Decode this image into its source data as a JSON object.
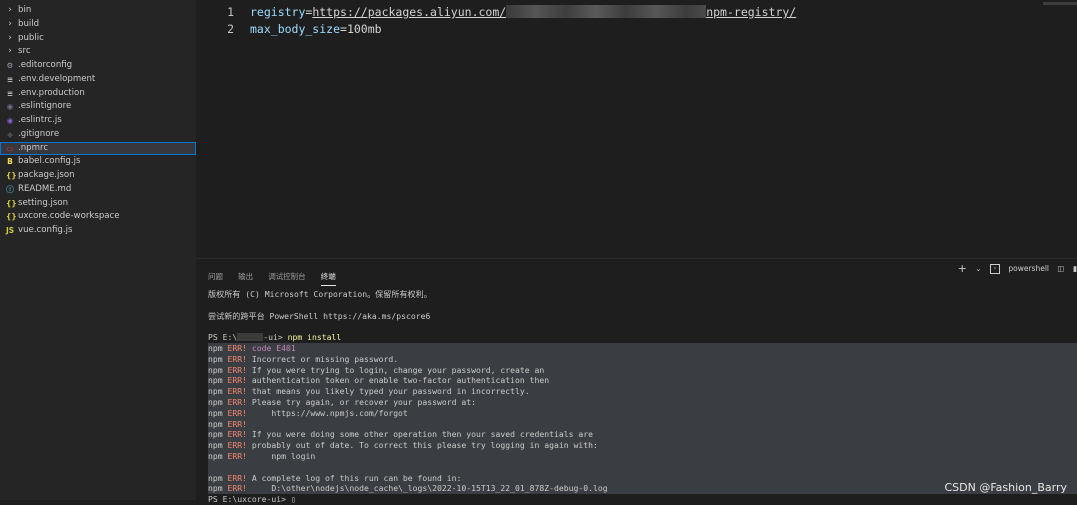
{
  "explorer": {
    "items": [
      {
        "type": "folder",
        "label": "bin",
        "icon": "chevron-right-icon",
        "glyph": "›",
        "color": "#c5c5c5"
      },
      {
        "type": "folder",
        "label": "build",
        "icon": "chevron-right-icon",
        "glyph": "›",
        "color": "#c5c5c5"
      },
      {
        "type": "folder",
        "label": "public",
        "icon": "chevron-right-icon",
        "glyph": "›",
        "color": "#c5c5c5"
      },
      {
        "type": "folder",
        "label": "src",
        "icon": "chevron-right-icon",
        "glyph": "›",
        "color": "#c5c5c5"
      },
      {
        "type": "file",
        "label": ".editorconfig",
        "icon": "gear-icon",
        "glyph": "⚙",
        "color": "#8fa3b3"
      },
      {
        "type": "file",
        "label": ".env.development",
        "icon": "list-icon",
        "glyph": "≡",
        "color": "#c5c5c5"
      },
      {
        "type": "file",
        "label": ".env.production",
        "icon": "list-icon",
        "glyph": "≡",
        "color": "#c5c5c5"
      },
      {
        "type": "file",
        "label": ".eslintignore",
        "icon": "circle-icon",
        "glyph": "◉",
        "color": "#6f6f8f"
      },
      {
        "type": "file",
        "label": ".eslintrc.js",
        "icon": "eslint-icon",
        "glyph": "◉",
        "color": "#8a5fd6"
      },
      {
        "type": "file",
        "label": ".gitignore",
        "icon": "git-icon",
        "glyph": "◆",
        "color": "#4d4d4d"
      },
      {
        "type": "file",
        "label": ".npmrc",
        "icon": "npm-icon",
        "glyph": "▭",
        "color": "#cb3837",
        "selected": true
      },
      {
        "type": "file",
        "label": "babel.config.js",
        "icon": "babel-icon",
        "glyph": "B",
        "color": "#f5da55"
      },
      {
        "type": "file",
        "label": "package.json",
        "icon": "json-braces-icon",
        "glyph": "{}",
        "color": "#cbcb41"
      },
      {
        "type": "file",
        "label": "README.md",
        "icon": "info-icon",
        "glyph": "ⓘ",
        "color": "#519aba"
      },
      {
        "type": "file",
        "label": "setting.json",
        "icon": "json-braces-icon",
        "glyph": "{}",
        "color": "#cbcb41"
      },
      {
        "type": "file",
        "label": "uxcore.code-workspace",
        "icon": "json-braces-icon",
        "glyph": "{}",
        "color": "#cbcb41"
      },
      {
        "type": "file",
        "label": "vue.config.js",
        "icon": "js-icon",
        "glyph": "JS",
        "color": "#cbcb41"
      }
    ]
  },
  "editor": {
    "lines": [
      {
        "num": "1",
        "key": "registry",
        "eq": "=",
        "value_prefix": "https://packages.aliyun.com/",
        "value_suffix": "npm-registry/"
      },
      {
        "num": "2",
        "key": "max_body_size",
        "eq": "=",
        "value": "100mb"
      }
    ]
  },
  "panel": {
    "tabs": [
      "问题",
      "输出",
      "调试控制台",
      "终端"
    ],
    "active_tab": "终端",
    "shell_label": "powershell",
    "terminal": {
      "lines": [
        {
          "text": "版权所有 (C) Microsoft Corporation。保留所有权利。"
        },
        {
          "text": ""
        },
        {
          "text": "尝试新的跨平台 PowerShell https://aka.ms/pscore6"
        },
        {
          "text": ""
        },
        {
          "prompt": "PS E:\\",
          "blurred": true,
          "prompt_tail": "-ui> ",
          "cmd": "npm install"
        },
        {
          "hl": true,
          "npm": "npm ",
          "err": "ERR! ",
          "code": "code E401",
          "rest": ""
        },
        {
          "hl": true,
          "npm": "npm ",
          "err": "ERR! ",
          "rest": "Incorrect or missing password."
        },
        {
          "hl": true,
          "npm": "npm ",
          "err": "ERR! ",
          "rest": "If you were trying to login, change your password, create an"
        },
        {
          "hl": true,
          "npm": "npm ",
          "err": "ERR! ",
          "rest": "authentication token or enable two-factor authentication then"
        },
        {
          "hl": true,
          "npm": "npm ",
          "err": "ERR! ",
          "rest": "that means you likely typed your password in incorrectly."
        },
        {
          "hl": true,
          "npm": "npm ",
          "err": "ERR! ",
          "rest": "Please try again, or recover your password at:"
        },
        {
          "hl": true,
          "npm": "npm ",
          "err": "ERR! ",
          "rest": "    https://www.npmjs.com/forgot"
        },
        {
          "hl": true,
          "npm": "npm ",
          "err": "ERR!",
          "rest": ""
        },
        {
          "hl": true,
          "npm": "npm ",
          "err": "ERR! ",
          "rest": "If you were doing some other operation then your saved credentials are"
        },
        {
          "hl": true,
          "npm": "npm ",
          "err": "ERR! ",
          "rest": "probably out of date. To correct this please try logging in again with:"
        },
        {
          "hl": true,
          "npm": "npm ",
          "err": "ERR! ",
          "rest": "    npm login"
        },
        {
          "hl": true,
          "text": ""
        },
        {
          "hl": true,
          "npm": "npm ",
          "err": "ERR! ",
          "rest": "A complete log of this run can be found in:"
        },
        {
          "hl": true,
          "npm": "npm ",
          "err": "ERR! ",
          "rest": "    D:\\other\\nodejs\\node_cache\\_logs\\2022-10-15T13_22_01_878Z-debug-0.log"
        },
        {
          "prompt": "PS E:\\uxcore-ui> ",
          "cursor": "▯"
        }
      ]
    }
  },
  "watermark": "CSDN @Fashion_Barry"
}
